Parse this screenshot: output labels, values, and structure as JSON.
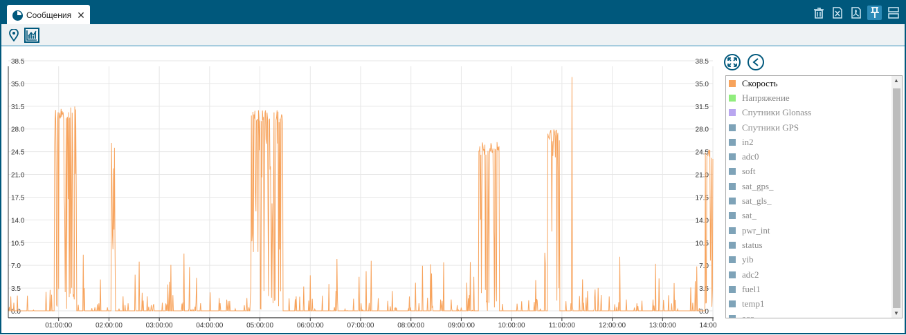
{
  "tab": {
    "title": "Сообщения",
    "close": "✕"
  },
  "toolbar_icons": [
    "trash-icon",
    "excel-icon",
    "pdf-icon",
    "pin-icon",
    "layout-icon"
  ],
  "view_icons": [
    "map-marker-icon",
    "chart-icon"
  ],
  "legend": {
    "items": [
      {
        "label": "Скорость",
        "color": "#f7a35c",
        "active": true
      },
      {
        "label": "Напряжение",
        "color": "#90ed7d",
        "active": false
      },
      {
        "label": "Спутники Glonass",
        "color": "#b9a6f0",
        "active": false
      },
      {
        "label": "Спутники GPS",
        "color": "#7ea3b8",
        "active": false
      },
      {
        "label": "in2",
        "color": "#7ea3b8",
        "active": false
      },
      {
        "label": "adc0",
        "color": "#7ea3b8",
        "active": false
      },
      {
        "label": "soft",
        "color": "#7ea3b8",
        "active": false
      },
      {
        "label": "sat_gps_",
        "color": "#7ea3b8",
        "active": false
      },
      {
        "label": "sat_gls_",
        "color": "#7ea3b8",
        "active": false
      },
      {
        "label": "sat_",
        "color": "#7ea3b8",
        "active": false
      },
      {
        "label": "pwr_int",
        "color": "#7ea3b8",
        "active": false
      },
      {
        "label": "status",
        "color": "#7ea3b8",
        "active": false
      },
      {
        "label": "yib",
        "color": "#7ea3b8",
        "active": false
      },
      {
        "label": "adc2",
        "color": "#7ea3b8",
        "active": false
      },
      {
        "label": "fuel1",
        "color": "#7ea3b8",
        "active": false
      },
      {
        "label": "temp1",
        "color": "#7ea3b8",
        "active": false
      },
      {
        "label": "acc",
        "color": "#7ea3b8",
        "active": false
      }
    ]
  },
  "chart_data": {
    "type": "line",
    "series": [
      {
        "name": "Скорость",
        "color": "#f7a35c",
        "bursts": [
          {
            "start": 0.92,
            "end": 1.35,
            "level": 30.5
          },
          {
            "start": 2.05,
            "end": 2.12,
            "level": 25
          },
          {
            "start": 4.82,
            "end": 5.45,
            "level": 30
          },
          {
            "start": 9.35,
            "end": 9.75,
            "level": 25
          },
          {
            "start": 10.72,
            "end": 10.95,
            "level": 27
          },
          {
            "start": 13.85,
            "end": 14.0,
            "level": 24
          }
        ],
        "peak": {
          "x": 11.2,
          "y": 36
        }
      }
    ],
    "x_ticks": [
      "01:00:00",
      "02:00:00",
      "03:00:00",
      "04:00:00",
      "05:00:00",
      "06:00:00",
      "07:00:00",
      "08:00:00",
      "09:00:00",
      "10:00:00",
      "11:00:00",
      "12:00:00",
      "13:00:00",
      "14:00:00"
    ],
    "y_ticks": [
      "0.0",
      "3.5",
      "7.0",
      "10.5",
      "14.0",
      "17.5",
      "21.0",
      "24.5",
      "28.0",
      "31.5",
      "35.0",
      "38.5"
    ],
    "xlim": [
      0,
      14
    ],
    "ylim": [
      0,
      38.5
    ],
    "grid": true
  }
}
